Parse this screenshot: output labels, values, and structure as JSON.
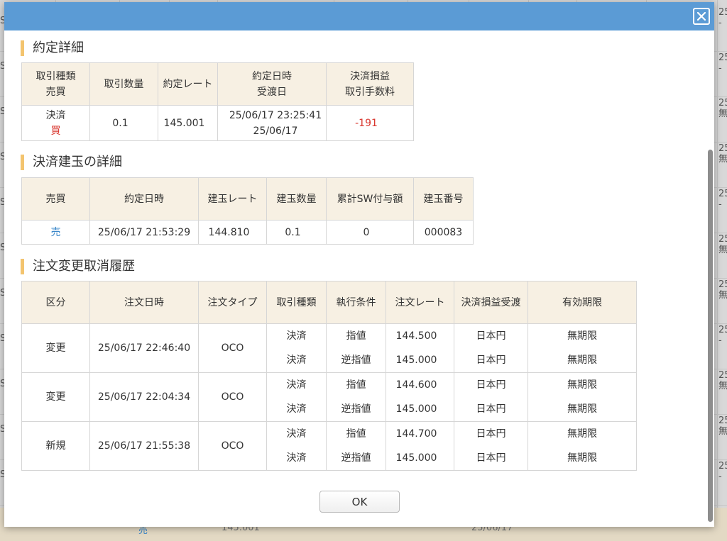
{
  "background": {
    "left_letter": "S",
    "right_cells": [
      {
        "top": "25",
        "bottom": "-"
      },
      {
        "top": "25",
        "bottom": "-"
      },
      {
        "top": "25",
        "bottom": "無"
      },
      {
        "top": "25",
        "bottom": "無"
      },
      {
        "top": "25",
        "bottom": "-"
      },
      {
        "top": "25",
        "bottom": "無"
      },
      {
        "top": "25",
        "bottom": "無"
      },
      {
        "top": "25",
        "bottom": "-"
      },
      {
        "top": "25",
        "bottom": "無"
      },
      {
        "top": "25",
        "bottom": "無"
      },
      {
        "top": "25",
        "bottom": "-"
      }
    ],
    "bottom_texts": [
      "売",
      "145.001",
      "25/06/17"
    ]
  },
  "modal": {
    "close_label": "close"
  },
  "section1": {
    "title": "約定詳細",
    "headers": [
      [
        "取引種類",
        "売買"
      ],
      [
        "取引数量"
      ],
      [
        "約定レート"
      ],
      [
        "約定日時",
        "受渡日"
      ],
      [
        "決済損益",
        "取引手数料"
      ]
    ],
    "row": {
      "type": "決済",
      "side": "買",
      "quantity": "0.1",
      "rate": "145.001",
      "exec_datetime": "25/06/17 23:25:41",
      "delivery_date": "25/06/17",
      "pnl": "-191",
      "fee": ""
    }
  },
  "section2": {
    "title": "決済建玉の詳細",
    "headers": [
      "売買",
      "約定日時",
      "建玉レート",
      "建玉数量",
      "累計SW付与額",
      "建玉番号"
    ],
    "row": {
      "side": "売",
      "datetime": "25/06/17 21:53:29",
      "rate": "144.810",
      "quantity": "0.1",
      "swap": "0",
      "position_no": "000083"
    }
  },
  "section3": {
    "title": "注文変更取消履歴",
    "headers": [
      "区分",
      "注文日時",
      "注文タイプ",
      "取引種類",
      "執行条件",
      "注文レート",
      "決済損益受渡",
      "有効期限"
    ],
    "rows": [
      {
        "kind": "変更",
        "datetime": "25/06/17 22:46:40",
        "order_type": "OCO",
        "legs": [
          {
            "trade": "決済",
            "cond": "指値",
            "rate": "144.500",
            "settle": "日本円",
            "expiry": "無期限"
          },
          {
            "trade": "決済",
            "cond": "逆指値",
            "rate": "145.000",
            "settle": "日本円",
            "expiry": "無期限"
          }
        ]
      },
      {
        "kind": "変更",
        "datetime": "25/06/17 22:04:34",
        "order_type": "OCO",
        "legs": [
          {
            "trade": "決済",
            "cond": "指値",
            "rate": "144.600",
            "settle": "日本円",
            "expiry": "無期限"
          },
          {
            "trade": "決済",
            "cond": "逆指値",
            "rate": "145.000",
            "settle": "日本円",
            "expiry": "無期限"
          }
        ]
      },
      {
        "kind": "新規",
        "datetime": "25/06/17 21:55:38",
        "order_type": "OCO",
        "legs": [
          {
            "trade": "決済",
            "cond": "指値",
            "rate": "144.700",
            "settle": "日本円",
            "expiry": "無期限"
          },
          {
            "trade": "決済",
            "cond": "逆指値",
            "rate": "145.000",
            "settle": "日本円",
            "expiry": "無期限"
          }
        ]
      }
    ]
  },
  "footer": {
    "ok_label": "OK"
  },
  "colors": {
    "header_blue": "#5b9bd5",
    "th_bg": "#f7f0e3",
    "accent": "#f3c46f",
    "buy_red": "#d9362e",
    "sell_blue": "#3a87c9"
  }
}
